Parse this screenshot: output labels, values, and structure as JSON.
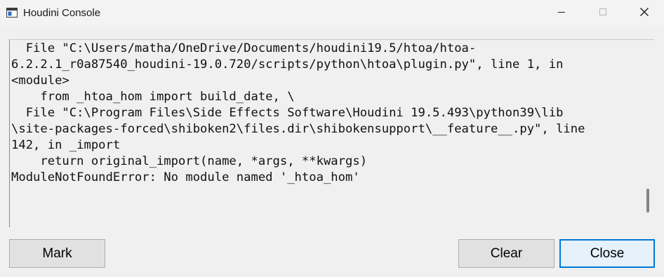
{
  "window": {
    "title": "Houdini Console"
  },
  "titlebar": {
    "icons": {
      "app": "console-window-icon",
      "minimize": "minimize-icon",
      "maximize": "maximize-icon",
      "close": "close-icon"
    }
  },
  "console": {
    "lines": [
      "  File \"C:\\Users/matha/OneDrive/Documents/houdini19.5/htoa/htoa-",
      "6.2.2.1_r0a87540_houdini-19.0.720/scripts/python\\htoa\\plugin.py\", line 1, in",
      "<module>",
      "    from _htoa_hom import build_date, \\",
      "  File \"C:\\Program Files\\Side Effects Software\\Houdini 19.5.493\\python39\\lib",
      "\\site-packages-forced\\shiboken2\\files.dir\\shibokensupport\\__feature__.py\", line",
      "142, in _import",
      "    return original_import(name, *args, **kwargs)",
      "ModuleNotFoundError: No module named '_htoa_hom'"
    ]
  },
  "buttons": {
    "mark": "Mark",
    "clear": "Clear",
    "close": "Close"
  }
}
